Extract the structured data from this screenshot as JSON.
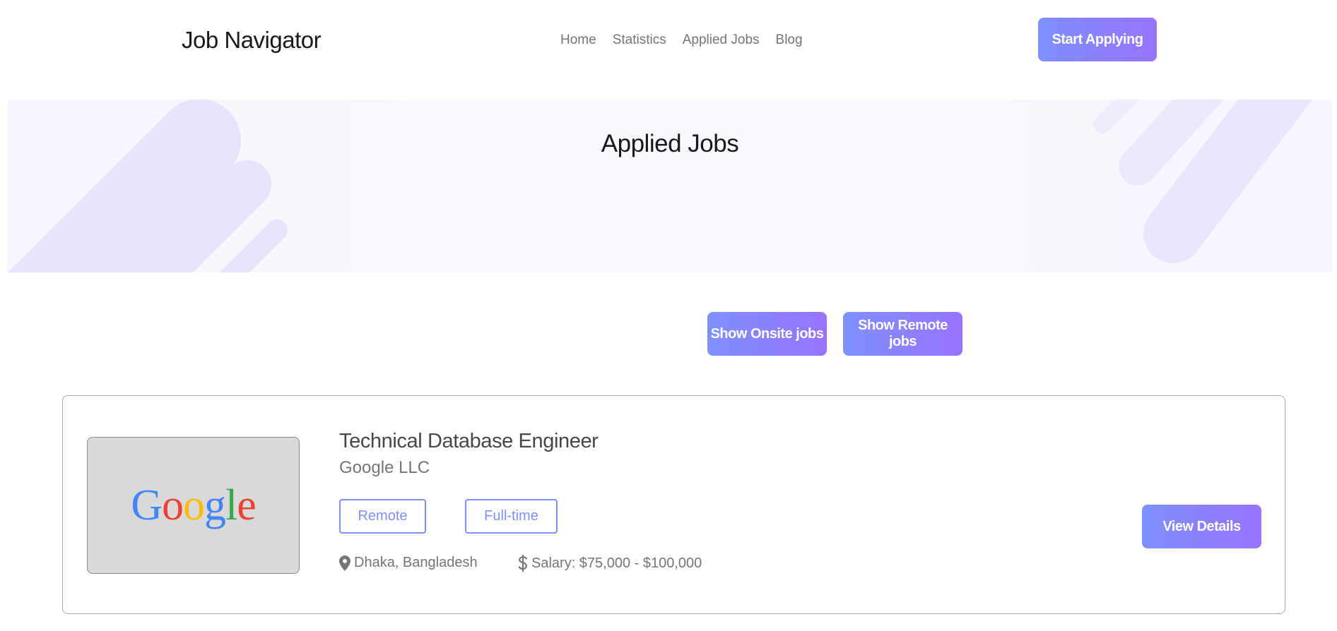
{
  "header": {
    "brand": "Job Navigator",
    "nav": [
      "Home",
      "Statistics",
      "Applied Jobs",
      "Blog"
    ],
    "cta_label": "Start Applying"
  },
  "banner": {
    "title": "Applied Jobs"
  },
  "filters": {
    "onsite_label": "Show Onsite jobs",
    "remote_label": "Show Remote jobs"
  },
  "jobs": [
    {
      "logo_text": [
        "G",
        "o",
        "o",
        "g",
        "l",
        "e"
      ],
      "title": "Technical Database Engineer",
      "company": "Google LLC",
      "tags": [
        "Remote",
        "Full-time"
      ],
      "location": "Dhaka, Bangladesh",
      "salary": "Salary: $75,000 - $100,000",
      "action_label": "View Details"
    }
  ],
  "colors": {
    "accent_start": "#7e90fe",
    "accent_end": "#9873ff",
    "google_blue": "#4285f4",
    "google_red": "#ea4335",
    "google_yellow": "#fbbc05",
    "google_green": "#34a853"
  },
  "icons": {
    "location": "map-pin-icon",
    "salary": "dollar-icon"
  }
}
